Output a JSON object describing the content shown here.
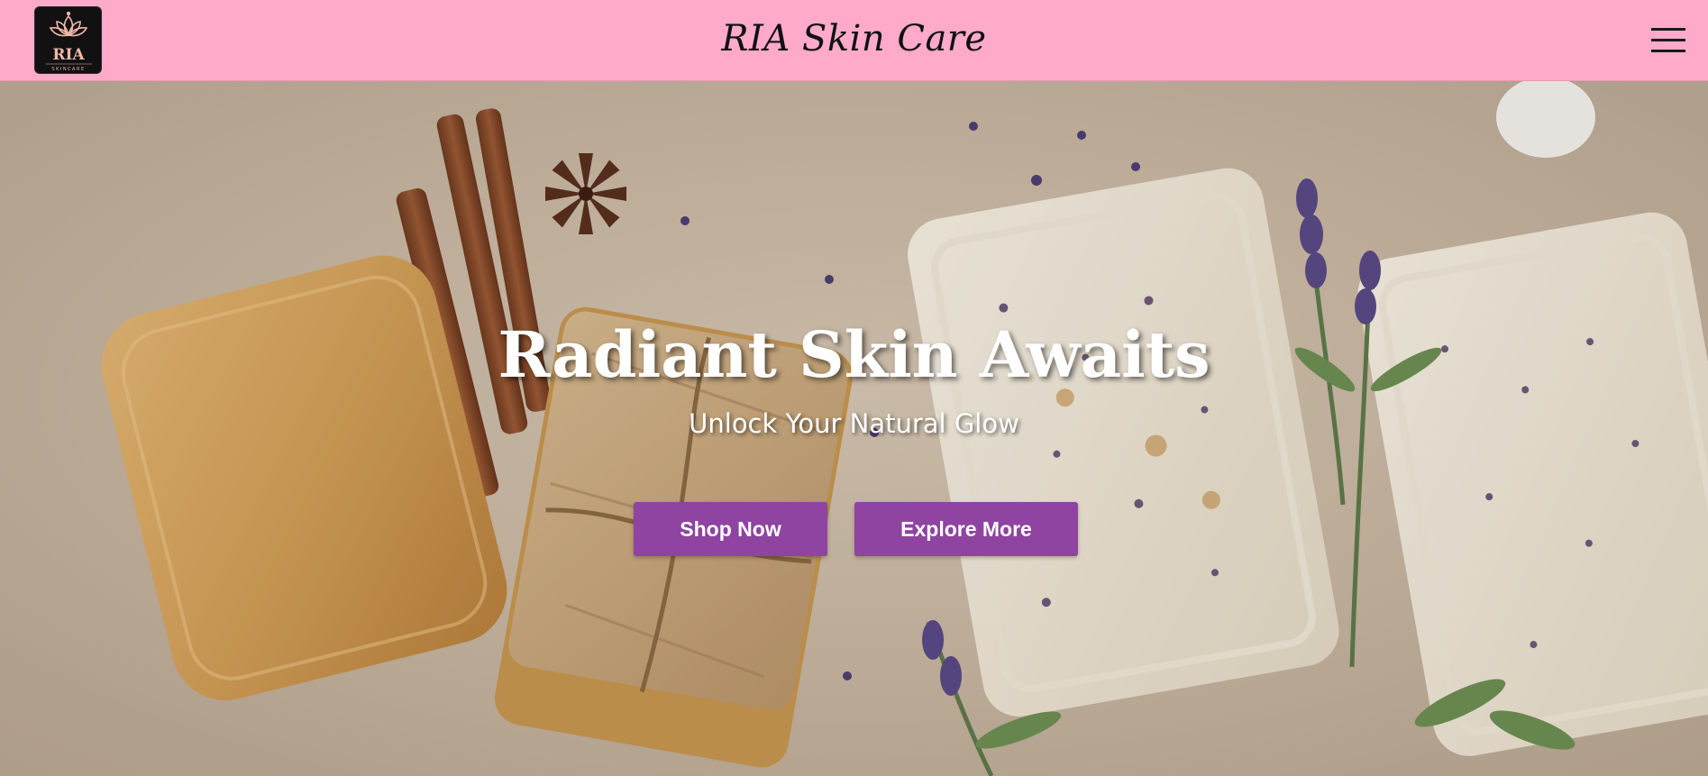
{
  "header": {
    "brand": "RIA Skin Care",
    "logo_text": "RIA",
    "logo_subtext": "SKINCARE",
    "background_color": "#ffaac8",
    "menu_icon": "hamburger-menu-icon"
  },
  "hero": {
    "title": "Radiant Skin Awaits",
    "subtitle": "Unlock Your Natural Glow",
    "buttons": {
      "shop": "Shop Now",
      "explore": "Explore More"
    },
    "button_color": "#8e44a0"
  }
}
